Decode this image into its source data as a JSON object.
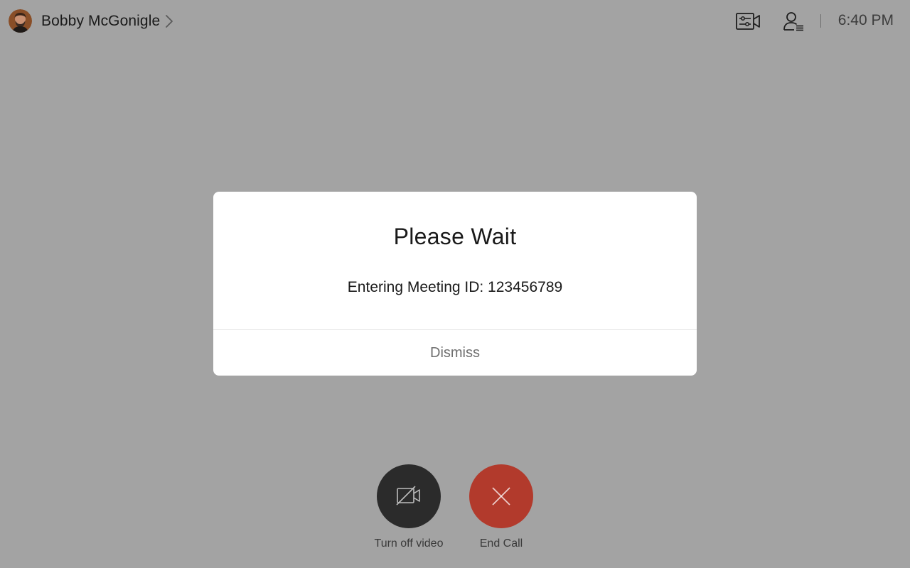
{
  "header": {
    "user_name": "Bobby McGonigle",
    "time": "6:40 PM",
    "icons": {
      "avatar": "user-avatar",
      "expand": "chevron-right-icon",
      "camera_settings": "camera-settings-icon",
      "participants": "participants-list-icon"
    }
  },
  "dialog": {
    "title": "Please Wait",
    "message": "Entering Meeting ID: 123456789",
    "dismiss_label": "Dismiss"
  },
  "controls": {
    "video": {
      "label": "Turn off video",
      "icon": "video-off-icon",
      "color": "#2b2b2b"
    },
    "end_call": {
      "label": "End Call",
      "icon": "close-icon",
      "color": "#b23a2c"
    }
  },
  "colors": {
    "background": "#a3a3a3",
    "dialog": "#ffffff"
  }
}
